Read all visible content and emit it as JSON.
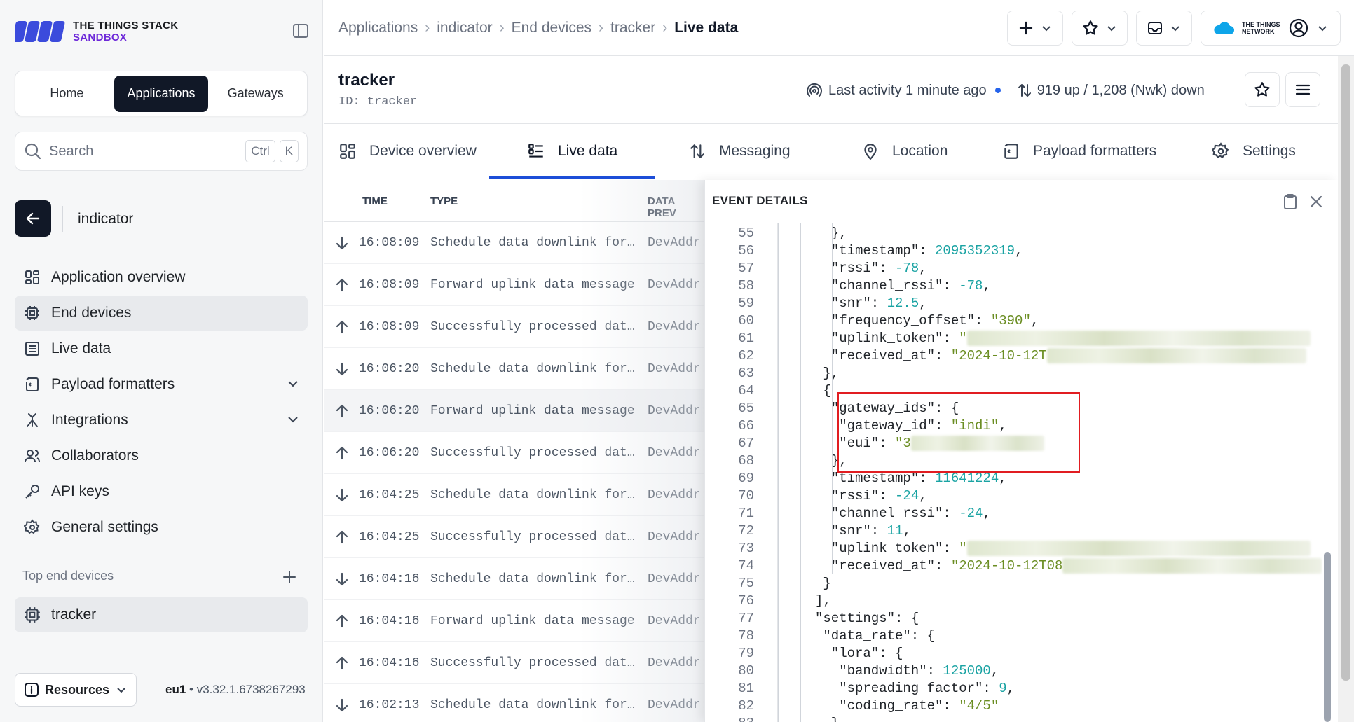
{
  "brand": {
    "line1": "THE THINGS STACK",
    "line2": "SANDBOX"
  },
  "switcher": {
    "home": "Home",
    "applications": "Applications",
    "gateways": "Gateways"
  },
  "search": {
    "placeholder": "Search",
    "key1": "Ctrl",
    "key2": "K"
  },
  "app": {
    "name": "indicator"
  },
  "nav": [
    {
      "label": "Application overview"
    },
    {
      "label": "End devices"
    },
    {
      "label": "Live data"
    },
    {
      "label": "Payload formatters"
    },
    {
      "label": "Integrations"
    },
    {
      "label": "Collaborators"
    },
    {
      "label": "API keys"
    },
    {
      "label": "General settings"
    }
  ],
  "top_devices": {
    "label": "Top end devices",
    "device": "tracker"
  },
  "footer": {
    "resources": "Resources",
    "region": "eu1",
    "version": "v3.32.1.6738267293"
  },
  "breadcrumb": [
    "Applications",
    "indicator",
    "End devices",
    "tracker",
    "Live data"
  ],
  "header": {
    "ttn_logo": "THE THINGS NETWORK"
  },
  "device": {
    "title": "tracker",
    "id": "ID: tracker",
    "activity": "Last activity 1 minute ago",
    "traffic": "919 up / 1,208 (Nwk) down"
  },
  "tabs": [
    "Device overview",
    "Live data",
    "Messaging",
    "Location",
    "Payload formatters",
    "Settings"
  ],
  "events": {
    "columns": {
      "time": "TIME",
      "type": "TYPE",
      "preview": "DATA PREV"
    },
    "rows": [
      {
        "dir": "down",
        "time": "16:08:09",
        "type": "Schedule data downlink for transmission",
        "preview": "DevAddr:"
      },
      {
        "dir": "up",
        "time": "16:08:09",
        "type": "Forward uplink data message",
        "preview": "DevAddr:"
      },
      {
        "dir": "up",
        "time": "16:08:09",
        "type": "Successfully processed data message",
        "preview": "DevAddr:"
      },
      {
        "dir": "down",
        "time": "16:06:20",
        "type": "Schedule data downlink for transmission",
        "preview": "DevAddr:"
      },
      {
        "dir": "up",
        "time": "16:06:20",
        "type": "Forward uplink data message",
        "preview": "DevAddr:"
      },
      {
        "dir": "up",
        "time": "16:06:20",
        "type": "Successfully processed data message",
        "preview": "DevAddr:"
      },
      {
        "dir": "down",
        "time": "16:04:25",
        "type": "Schedule data downlink for transmission",
        "preview": "DevAddr:"
      },
      {
        "dir": "up",
        "time": "16:04:25",
        "type": "Successfully processed data message",
        "preview": "DevAddr:"
      },
      {
        "dir": "down",
        "time": "16:04:16",
        "type": "Schedule data downlink for transmission",
        "preview": "DevAddr:"
      },
      {
        "dir": "up",
        "time": "16:04:16",
        "type": "Forward uplink data message",
        "preview": "DevAddr:"
      },
      {
        "dir": "up",
        "time": "16:04:16",
        "type": "Successfully processed data message",
        "preview": "DevAddr:"
      },
      {
        "dir": "down",
        "time": "16:02:13",
        "type": "Schedule data downlink for transmission",
        "preview": "DevAddr:"
      }
    ]
  },
  "details": {
    "title": "EVENT DETAILS",
    "lines": [
      {
        "n": "55",
        "t": "},"
      },
      {
        "n": "56",
        "t": "\"timestamp\": 2095352319,"
      },
      {
        "n": "57",
        "t": "\"rssi\": -78,"
      },
      {
        "n": "58",
        "t": "\"channel_rssi\": -78,"
      },
      {
        "n": "59",
        "t": "\"snr\": 12.5,"
      },
      {
        "n": "60",
        "t": "\"frequency_offset\": \"390\","
      },
      {
        "n": "61",
        "t": "\"uplink_token\": \""
      },
      {
        "n": "62",
        "t": "\"received_at\": \"2024-10-12T"
      },
      {
        "n": "63",
        "t": "},"
      },
      {
        "n": "64",
        "t": "{"
      },
      {
        "n": "65",
        "t": "\"gateway_ids\": {"
      },
      {
        "n": "66",
        "t": "\"gateway_id\": \"indi\","
      },
      {
        "n": "67",
        "t": "\"eui\": \"3"
      },
      {
        "n": "68",
        "t": "},"
      },
      {
        "n": "69",
        "t": "\"timestamp\": 11641224,"
      },
      {
        "n": "70",
        "t": "\"rssi\": -24,"
      },
      {
        "n": "71",
        "t": "\"channel_rssi\": -24,"
      },
      {
        "n": "72",
        "t": "\"snr\": 11,"
      },
      {
        "n": "73",
        "t": "\"uplink_token\": \""
      },
      {
        "n": "74",
        "t": "\"received_at\": \"2024-10-12T08"
      },
      {
        "n": "75",
        "t": "}"
      },
      {
        "n": "76",
        "t": "],"
      },
      {
        "n": "77",
        "t": "\"settings\": {"
      },
      {
        "n": "78",
        "t": "\"data_rate\": {"
      },
      {
        "n": "79",
        "t": "\"lora\": {"
      },
      {
        "n": "80",
        "t": "\"bandwidth\": 125000,"
      },
      {
        "n": "81",
        "t": "\"spreading_factor\": 9,"
      },
      {
        "n": "82",
        "t": "\"coding_rate\": \"4/5\""
      },
      {
        "n": "83",
        "t": "},"
      }
    ]
  },
  "colors": {
    "accent": "#1d4ed8",
    "brand_purple": "#6d28d9",
    "highlight": "#e11d21",
    "dark": "#111827"
  }
}
